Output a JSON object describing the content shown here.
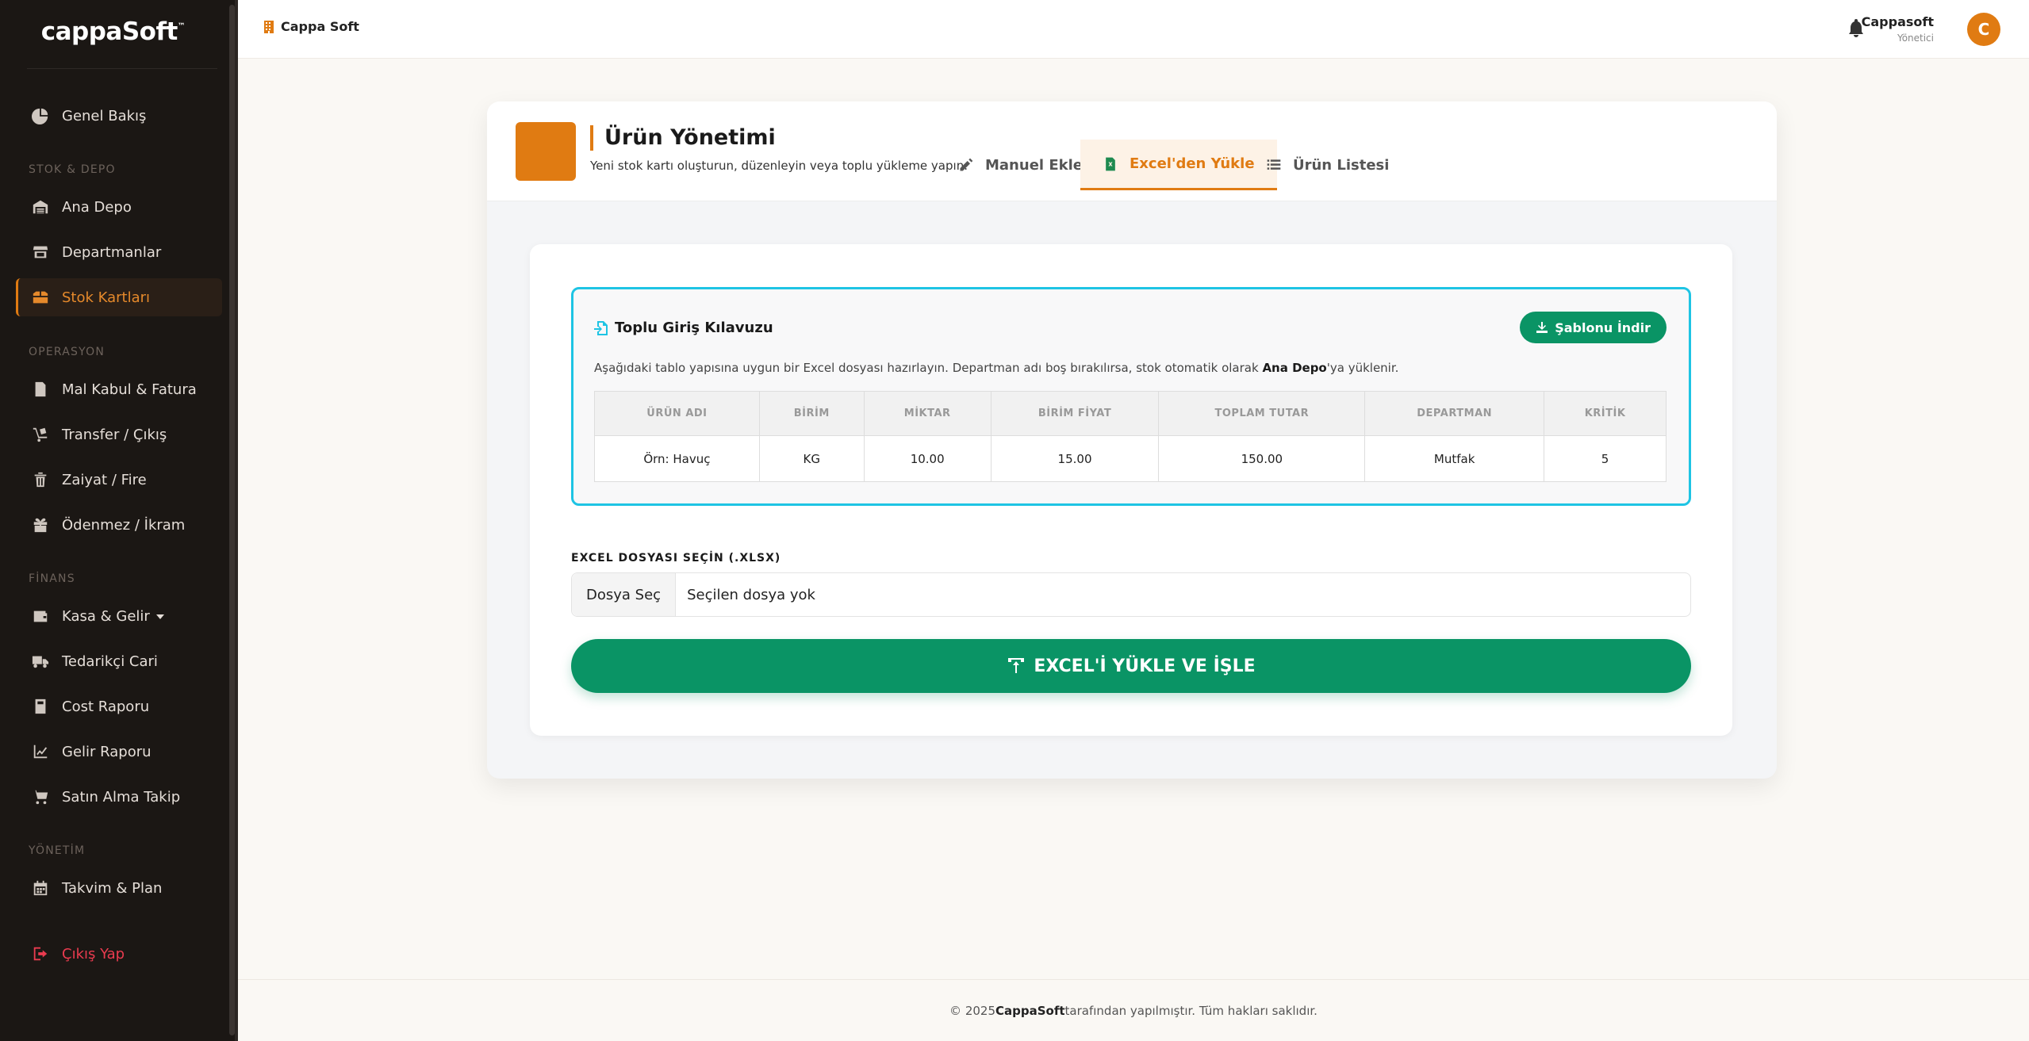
{
  "brand": {
    "name": "cappaSoft",
    "tm": "™"
  },
  "sidebar": {
    "sections": {
      "stock": "STOK & DEPO",
      "ops": "OPERASYON",
      "finance": "FİNANS",
      "admin": "YÖNETİM"
    },
    "items": [
      {
        "label": "Genel Bakış",
        "icon": "pie-chart-icon"
      },
      {
        "label": "Ana Depo",
        "icon": "warehouse-icon"
      },
      {
        "label": "Departmanlar",
        "icon": "store-icon"
      },
      {
        "label": "Stok Kartları",
        "icon": "boxes-icon",
        "active": true
      },
      {
        "label": "Mal Kabul & Fatura",
        "icon": "invoice-icon"
      },
      {
        "label": "Transfer / Çıkış",
        "icon": "dolly-icon"
      },
      {
        "label": "Zaiyat / Fire",
        "icon": "trash-icon"
      },
      {
        "label": "Ödenmez / İkram",
        "icon": "gift-icon"
      },
      {
        "label": "Kasa & Gelir",
        "icon": "wallet-icon"
      },
      {
        "label": "Tedarikçi Cari",
        "icon": "truck-icon"
      },
      {
        "label": "Cost Raporu",
        "icon": "calculator-icon"
      },
      {
        "label": "Gelir Raporu",
        "icon": "line-chart-icon"
      },
      {
        "label": "Satın Alma Takip",
        "icon": "cart-icon"
      },
      {
        "label": "Takvim & Plan",
        "icon": "calendar-icon"
      }
    ],
    "logout": "Çıkış Yap"
  },
  "topbar": {
    "breadcrumb": "Cappa Soft",
    "user_name": "Cappasoft",
    "user_role": "Yönetici",
    "avatar_letter": "C"
  },
  "page": {
    "title": "Ürün Yönetimi",
    "subtitle": "Yeni stok kartı oluşturun, düzenleyin veya toplu yükleme yapın.",
    "tabs": [
      {
        "label": "Manuel Ekle",
        "icon": "pencil-icon"
      },
      {
        "label": "Excel'den Yükle",
        "icon": "excel-file-icon",
        "active": true
      },
      {
        "label": "Ürün Listesi",
        "icon": "list-icon"
      }
    ]
  },
  "guide": {
    "title": "Toplu Giriş Kılavuzu",
    "template_button": "Şablonu İndir",
    "desc_before": "Aşağıdaki tablo yapısına uygun bir Excel dosyası hazırlayın. Departman adı boş bırakılırsa, stok otomatik olarak ",
    "desc_bold": "Ana Depo",
    "desc_after": "'ya yüklenir.",
    "columns": [
      "ÜRÜN ADI",
      "BİRİM",
      "MİKTAR",
      "BİRİM FİYAT",
      "TOPLAM TUTAR",
      "DEPARTMAN",
      "KRİTİK"
    ],
    "row": [
      "Örn: Havuç",
      "KG",
      "10.00",
      "15.00",
      "150.00",
      "Mutfak",
      "5"
    ]
  },
  "upload": {
    "label": "EXCEL DOSYASI SEÇİN (.XLSX)",
    "choose_button": "Dosya Seç",
    "no_file": "Seçilen dosya yok",
    "submit": "EXCEL'İ YÜKLE VE İŞLE"
  },
  "footer": {
    "before": "© 2025 ",
    "brand": "CappaSoft",
    "after": " tarafından yapılmıştır. Tüm hakları saklıdır."
  },
  "colors": {
    "accent": "#e07b12",
    "success": "#0a9465",
    "info": "#1ec4e4",
    "sidebar_bg": "#1b1714"
  }
}
